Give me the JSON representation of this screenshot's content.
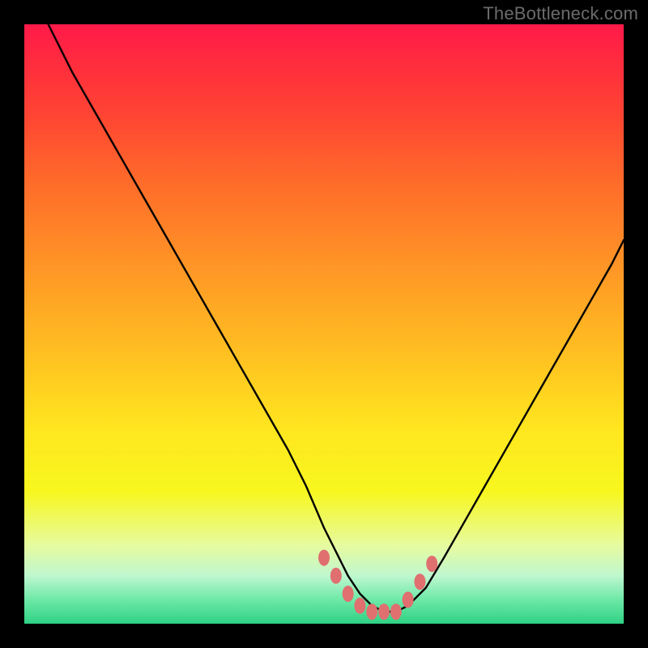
{
  "watermark": "TheBottleneck.com",
  "chart_data": {
    "type": "line",
    "title": "",
    "xlabel": "",
    "ylabel": "",
    "xlim": [
      0,
      100
    ],
    "ylim": [
      0,
      100
    ],
    "grid": false,
    "series": [
      {
        "name": "bottleneck-curve",
        "x": [
          4,
          8,
          12,
          16,
          20,
          24,
          28,
          32,
          36,
          40,
          44,
          47,
          50,
          52,
          54,
          56,
          58,
          60,
          62,
          64,
          67,
          70,
          74,
          78,
          82,
          86,
          90,
          94,
          98,
          100
        ],
        "values": [
          100,
          92,
          85,
          78,
          71,
          64,
          57,
          50,
          43,
          36,
          29,
          23,
          16,
          12,
          8,
          5,
          3,
          2,
          2,
          3,
          6,
          11,
          18,
          25,
          32,
          39,
          46,
          53,
          60,
          64
        ]
      }
    ],
    "annotations": [
      {
        "name": "marker",
        "x": 50,
        "y": 11
      },
      {
        "name": "marker",
        "x": 52,
        "y": 8
      },
      {
        "name": "marker",
        "x": 54,
        "y": 5
      },
      {
        "name": "marker",
        "x": 56,
        "y": 3
      },
      {
        "name": "marker",
        "x": 58,
        "y": 2
      },
      {
        "name": "marker",
        "x": 60,
        "y": 2
      },
      {
        "name": "marker",
        "x": 62,
        "y": 2
      },
      {
        "name": "marker",
        "x": 64,
        "y": 4
      },
      {
        "name": "marker",
        "x": 66,
        "y": 7
      },
      {
        "name": "marker",
        "x": 68,
        "y": 10
      }
    ],
    "marker_color": "#e06f70",
    "curve_color": "#000000",
    "background_gradient": [
      "#ff1a4a",
      "#ffe71f",
      "#2fd184"
    ]
  }
}
